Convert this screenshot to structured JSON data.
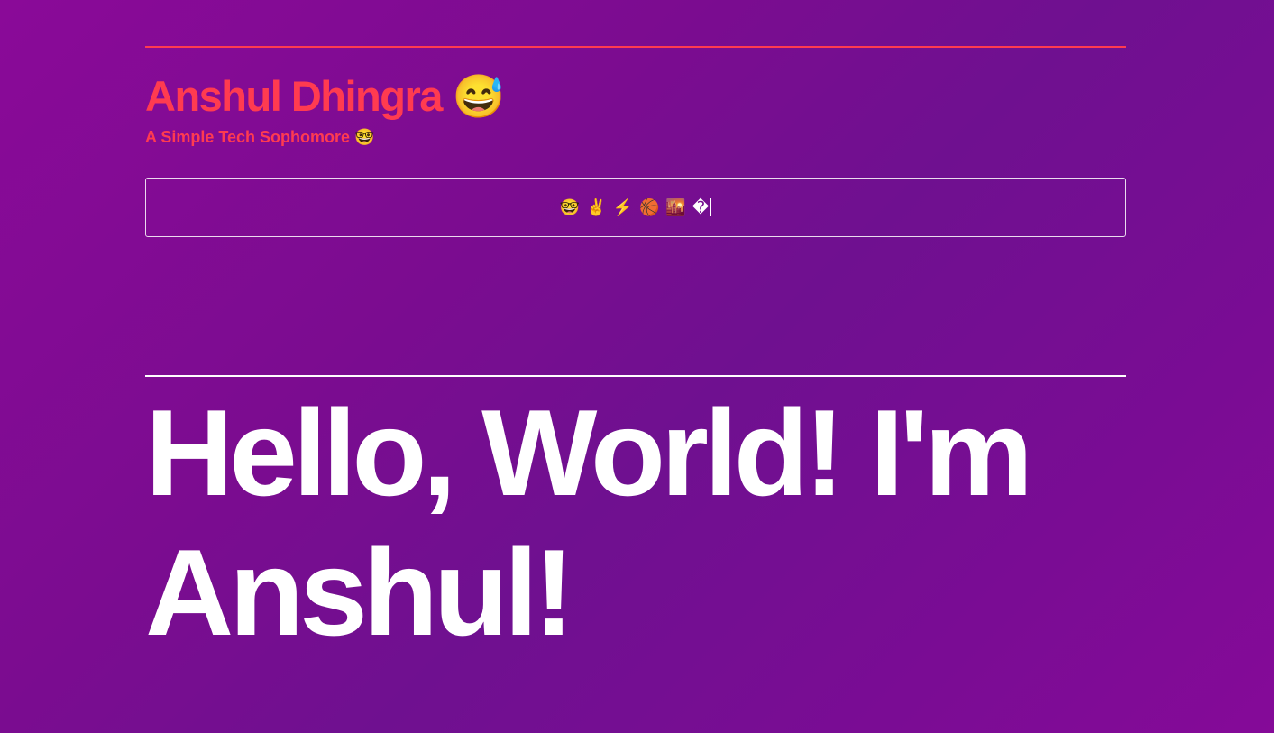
{
  "header": {
    "title": "Anshul Dhingra 😅",
    "subtitle": "A Simple Tech Sophomore 🤓"
  },
  "typing_box": {
    "text": "🤓 ✌️ ⚡ 🏀 🌇 �"
  },
  "hero": {
    "text": "Hello, World! I'm Anshul!"
  },
  "colors": {
    "accent": "#ff3b50",
    "background_start": "#8a0a98",
    "background_end": "#6f1090",
    "text": "#ffffff"
  }
}
